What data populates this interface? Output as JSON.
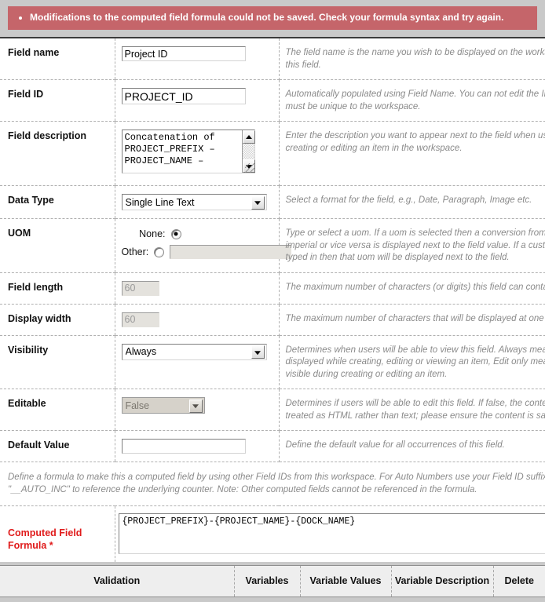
{
  "banner": {
    "type": "error",
    "color": "#c5656a",
    "message": "Modifications to the computed field formula could not be saved. Check your formula syntax and try again."
  },
  "form": {
    "rows": [
      {
        "label": "Field name",
        "widget": "text",
        "value": "Project ID",
        "help": "The field name is the name you wish to be displayed on the workspace for this field."
      },
      {
        "label": "Field ID",
        "widget": "text",
        "value": "PROJECT_ID",
        "help": "Automatically populated using Field Name. You can not edit the ID, and it must be unique to the workspace."
      },
      {
        "label": "Field description",
        "widget": "textarea",
        "value": "Concatenation of\nPROJECT_PREFIX –\nPROJECT_NAME –",
        "help": "Enter the description you want to appear next to the field when users are creating or editing an item in the workspace."
      },
      {
        "label": "Data Type",
        "widget": "select",
        "value": "Single Line Text",
        "help": "Select a format for the field, e.g., Date, Paragraph, Image etc."
      },
      {
        "label": "UOM",
        "widget": "radio-group",
        "help": "Type or select a uom. If a uom is selected then a conversion from metric to imperial or vice versa is displayed next to the field value. If a custom uom is typed in then that uom will be displayed next to the field.",
        "options": [
          {
            "label": "None:",
            "selected": true
          },
          {
            "label": "Other:",
            "selected": false,
            "input_value": "",
            "input_disabled": true
          }
        ]
      },
      {
        "label": "Field length",
        "widget": "text",
        "value": "60",
        "disabled": true,
        "help": "The maximum number of characters (or digits) this field can contain."
      },
      {
        "label": "Display width",
        "widget": "text",
        "value": "60",
        "disabled": true,
        "help": "The maximum number of characters that will be displayed at one time."
      },
      {
        "label": "Visibility",
        "widget": "select",
        "value": "Always",
        "help": "Determines when users will be able to view this field. Always means it will be displayed while creating, editing or viewing an item, Edit only means it will be visible during creating or editing an item."
      },
      {
        "label": "Editable",
        "widget": "select",
        "value": "False",
        "disabled": true,
        "help": "Determines if users will be able to edit this field. If false, the content is treated as HTML rather than text; please ensure the content is safe."
      },
      {
        "label": "Default Value",
        "widget": "text",
        "value": "",
        "help": "Define the default value for all occurrences of this field."
      }
    ],
    "formula_note": "Define a formula to make this a computed field by using other Field IDs from this workspace. For Auto Numbers use your Field ID suffixed with \"__AUTO_INC\" to reference the underlying counter. Note: Other computed fields cannot be referenced in the formula.",
    "formula_label": "Computed Field Formula *",
    "formula_value": "{PROJECT_PREFIX}-{PROJECT_NAME}-{DOCK_NAME}",
    "required_color": "#e01b1b"
  },
  "bottom_table": {
    "headers": [
      "Validation",
      "Variables",
      "Variable Values",
      "Variable Description",
      "Delete"
    ]
  }
}
